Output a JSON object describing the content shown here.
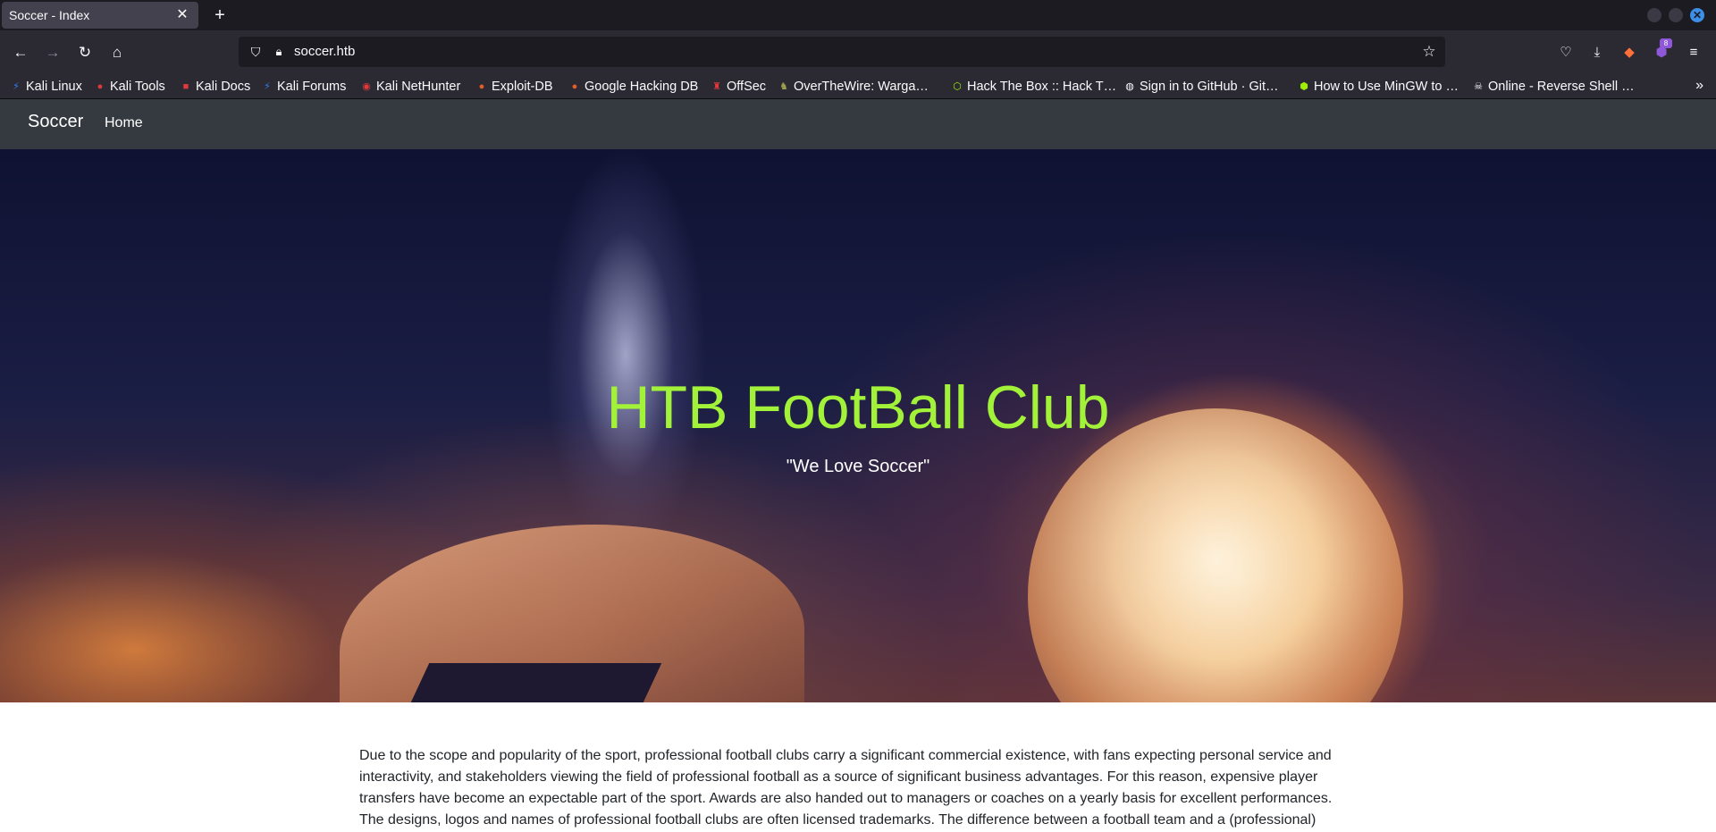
{
  "browser": {
    "tab_title": "Soccer - Index",
    "tab_close_icon": "close-icon",
    "new_tab_icon": "plus-icon",
    "url": "soccer.htb",
    "extension_badge": "8",
    "bookmarks": [
      {
        "label": "Kali Linux",
        "icon": "kali-icon",
        "color": "#367bf0"
      },
      {
        "label": "Kali Tools",
        "icon": "kali-tools-icon",
        "color": "#e1393b"
      },
      {
        "label": "Kali Docs",
        "icon": "kali-docs-icon",
        "color": "#e1393b"
      },
      {
        "label": "Kali Forums",
        "icon": "kali-icon",
        "color": "#367bf0"
      },
      {
        "label": "Kali NetHunter",
        "icon": "nethunter-icon",
        "color": "#e1393b"
      },
      {
        "label": "Exploit-DB",
        "icon": "exploitdb-icon",
        "color": "#e35c2a"
      },
      {
        "label": "Google Hacking DB",
        "icon": "ghdb-icon",
        "color": "#e35c2a"
      },
      {
        "label": "OffSec",
        "icon": "offsec-icon",
        "color": "#e1393b"
      },
      {
        "label": "OverTheWire: Warga…",
        "icon": "overthewire-icon",
        "color": "#9ea04f"
      },
      {
        "label": "Hack The Box :: Hack T…",
        "icon": "htb-icon",
        "color": "#9fef00"
      },
      {
        "label": "Sign in to GitHub · Git…",
        "icon": "github-icon",
        "color": "#fbfbfe"
      },
      {
        "label": "How to Use MinGW to …",
        "icon": "mingw-icon",
        "color": "#9fef00"
      },
      {
        "label": "Online - Reverse Shell …",
        "icon": "skull-icon",
        "color": "#fbfbfe"
      }
    ]
  },
  "site": {
    "brand": "Soccer",
    "nav": {
      "home": "Home"
    },
    "hero": {
      "title": "HTB FootBall Club",
      "subtitle": "\"We Love Soccer\"",
      "title_color": "#a3f23a"
    },
    "body_text": "Due to the scope and popularity of the sport, professional football clubs carry a significant commercial existence, with fans expecting personal service and interactivity, and stakeholders viewing the field of professional football as a source of significant business advantages. For this reason, expensive player transfers have become an expectable part of the sport. Awards are also handed out to managers or coaches on a yearly basis for excellent performances. The designs, logos and names of professional football clubs are often licensed trademarks. The difference between a football team and a (professional)"
  }
}
